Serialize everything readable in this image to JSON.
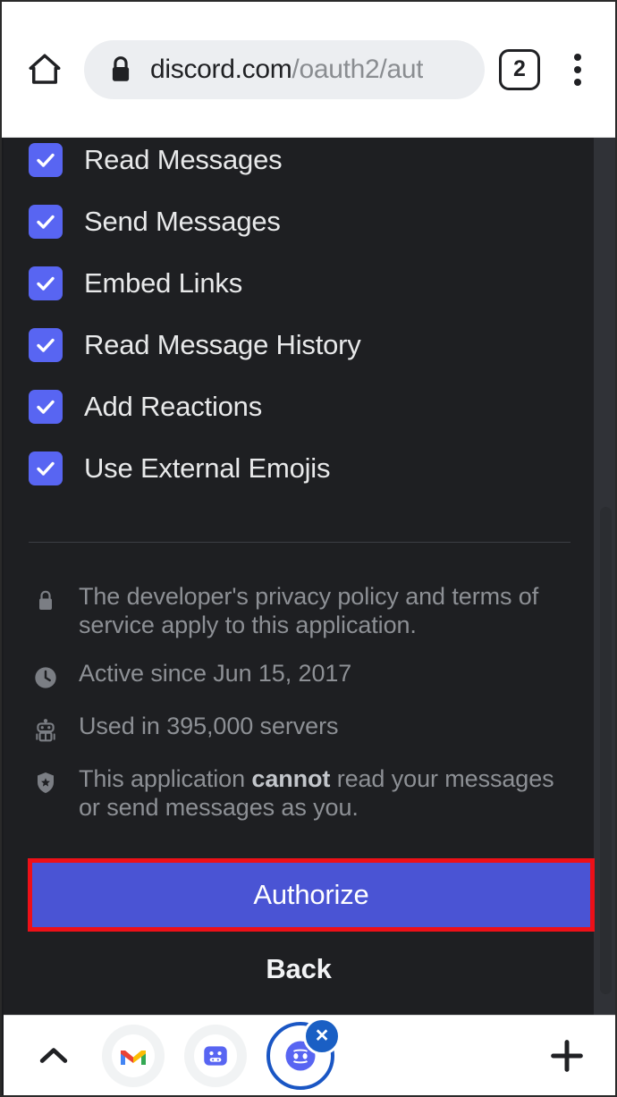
{
  "browser": {
    "home_icon": "home-icon",
    "lock_icon": "lock-icon",
    "url_domain": "discord.com",
    "url_path": "/oauth2/aut",
    "tab_count": "2",
    "menu_icon": "kebab-menu-icon"
  },
  "permissions": [
    {
      "label": "Read Messages",
      "checked": true
    },
    {
      "label": "Send Messages",
      "checked": true
    },
    {
      "label": "Embed Links",
      "checked": true
    },
    {
      "label": "Read Message History",
      "checked": true
    },
    {
      "label": "Add Reactions",
      "checked": true
    },
    {
      "label": "Use External Emojis",
      "checked": true
    }
  ],
  "info": [
    {
      "icon": "lock-icon",
      "text": "The developer's privacy policy and terms of service apply to this application."
    },
    {
      "icon": "clock-icon",
      "text": "Active since Jun 15, 2017"
    },
    {
      "icon": "robot-icon",
      "text": "Used in 395,000 servers"
    },
    {
      "icon": "shield-icon",
      "text_before": "This application ",
      "text_bold": "cannot",
      "text_after": " read your messages or send messages as you."
    }
  ],
  "actions": {
    "authorize_label": "Authorize",
    "back_label": "Back"
  },
  "bottom_bar": {
    "chevron_icon": "chevron-up-icon",
    "apps": [
      {
        "name": "gmail-icon"
      },
      {
        "name": "bot-app-icon"
      }
    ],
    "active_tab": {
      "name": "discord-icon",
      "close_label": "×"
    },
    "plus_icon": "plus-icon"
  },
  "colors": {
    "accent": "#5865f2",
    "button": "#4a54d4",
    "highlight": "#ee1018",
    "page_bg": "#1e1f22",
    "text": "#e8e9ea",
    "muted": "#8d9095"
  }
}
